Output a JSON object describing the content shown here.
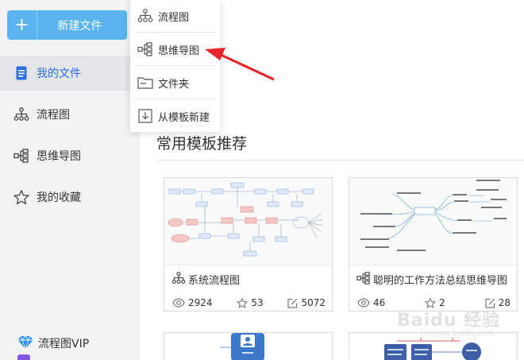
{
  "sidebar": {
    "new_button": "新建文件",
    "items": [
      {
        "label": "我的文件",
        "icon": "document-icon",
        "active": true
      },
      {
        "label": "流程图",
        "icon": "flowchart-icon"
      },
      {
        "label": "思维导图",
        "icon": "mindmap-icon"
      },
      {
        "label": "我的收藏",
        "icon": "star-icon"
      }
    ],
    "vip": "流程图VIP"
  },
  "dropdown": {
    "items": [
      {
        "label": "流程图",
        "icon": "flowchart-icon"
      },
      {
        "label": "思维导图",
        "icon": "mindmap-icon"
      },
      {
        "label": "文件夹",
        "icon": "folder-icon"
      },
      {
        "label": "从模板新建",
        "icon": "template-icon"
      }
    ]
  },
  "main": {
    "section_title": "常用模板推荐",
    "cards": [
      {
        "name": "系统流程图",
        "views": "2924",
        "likes": "53",
        "edits": "5072"
      },
      {
        "name": "聪明的工作方法总结思维导图",
        "views": "46",
        "likes": "2",
        "edits": "28"
      }
    ]
  },
  "watermark": {
    "text": "Baidu 经验",
    "sub": "jingyan.baidu.com"
  },
  "colors": {
    "accent": "#5ab4ef",
    "active_text": "#2b6ee8",
    "arrow": "#e8242a"
  }
}
